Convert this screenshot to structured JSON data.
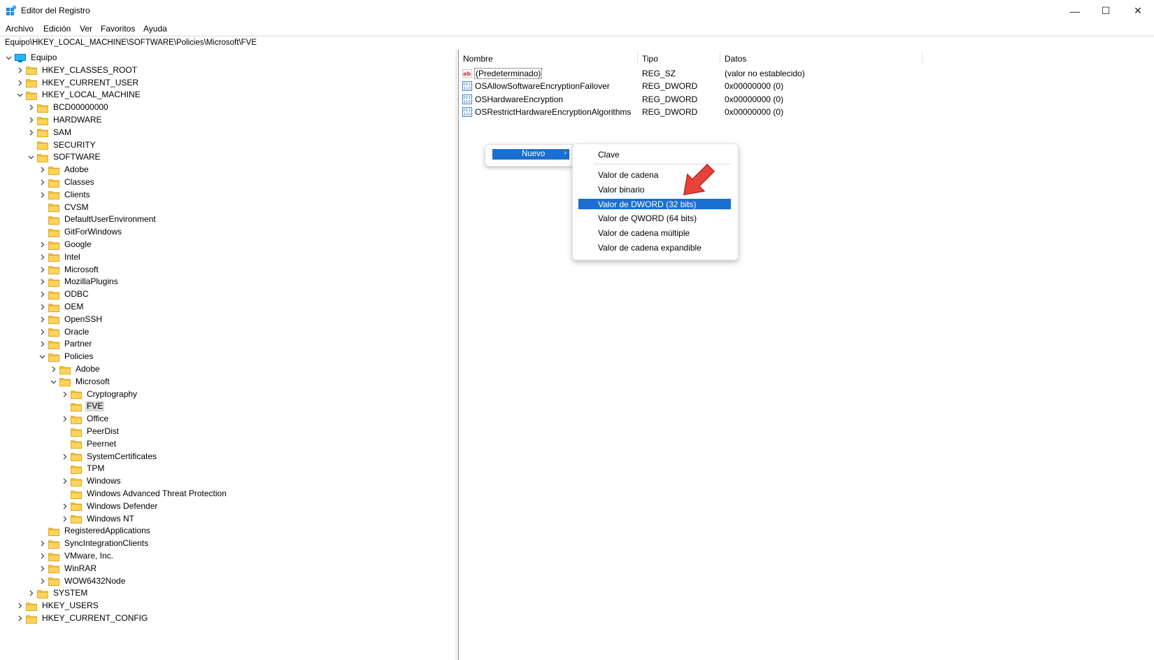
{
  "window": {
    "title": "Editor del Registro",
    "minimize": "—",
    "maximize": "☐",
    "close": "✕"
  },
  "menu": [
    "Archivo",
    "Edición",
    "Ver",
    "Favoritos",
    "Ayuda"
  ],
  "address": "Equipo\\HKEY_LOCAL_MACHINE\\SOFTWARE\\Policies\\Microsoft\\FVE",
  "tree": [
    {
      "label": "Equipo",
      "level": 0,
      "expander": "open",
      "icon": "computer-icon"
    },
    {
      "label": "HKEY_CLASSES_ROOT",
      "level": 1,
      "expander": "closed",
      "icon": "folder-icon"
    },
    {
      "label": "HKEY_CURRENT_USER",
      "level": 1,
      "expander": "closed",
      "icon": "folder-icon"
    },
    {
      "label": "HKEY_LOCAL_MACHINE",
      "level": 1,
      "expander": "open",
      "icon": "folder-icon"
    },
    {
      "label": "BCD00000000",
      "level": 2,
      "expander": "closed",
      "icon": "folder-icon"
    },
    {
      "label": "HARDWARE",
      "level": 2,
      "expander": "closed",
      "icon": "folder-icon"
    },
    {
      "label": "SAM",
      "level": 2,
      "expander": "closed",
      "icon": "folder-icon"
    },
    {
      "label": "SECURITY",
      "level": 2,
      "expander": "none",
      "icon": "folder-icon"
    },
    {
      "label": "SOFTWARE",
      "level": 2,
      "expander": "open",
      "icon": "folder-icon"
    },
    {
      "label": "Adobe",
      "level": 3,
      "expander": "closed",
      "icon": "folder-icon"
    },
    {
      "label": "Classes",
      "level": 3,
      "expander": "closed",
      "icon": "folder-icon"
    },
    {
      "label": "Clients",
      "level": 3,
      "expander": "closed",
      "icon": "folder-icon"
    },
    {
      "label": "CVSM",
      "level": 3,
      "expander": "none",
      "icon": "folder-icon"
    },
    {
      "label": "DefaultUserEnvironment",
      "level": 3,
      "expander": "none",
      "icon": "folder-icon"
    },
    {
      "label": "GitForWindows",
      "level": 3,
      "expander": "none",
      "icon": "folder-icon"
    },
    {
      "label": "Google",
      "level": 3,
      "expander": "closed",
      "icon": "folder-icon"
    },
    {
      "label": "Intel",
      "level": 3,
      "expander": "closed",
      "icon": "folder-icon"
    },
    {
      "label": "Microsoft",
      "level": 3,
      "expander": "closed",
      "icon": "folder-icon"
    },
    {
      "label": "MozillaPlugins",
      "level": 3,
      "expander": "closed",
      "icon": "folder-icon"
    },
    {
      "label": "ODBC",
      "level": 3,
      "expander": "closed",
      "icon": "folder-icon"
    },
    {
      "label": "OEM",
      "level": 3,
      "expander": "closed",
      "icon": "folder-icon"
    },
    {
      "label": "OpenSSH",
      "level": 3,
      "expander": "closed",
      "icon": "folder-icon"
    },
    {
      "label": "Oracle",
      "level": 3,
      "expander": "closed",
      "icon": "folder-icon"
    },
    {
      "label": "Partner",
      "level": 3,
      "expander": "closed",
      "icon": "folder-icon"
    },
    {
      "label": "Policies",
      "level": 3,
      "expander": "open",
      "icon": "folder-icon"
    },
    {
      "label": "Adobe",
      "level": 4,
      "expander": "closed",
      "icon": "folder-icon"
    },
    {
      "label": "Microsoft",
      "level": 4,
      "expander": "open",
      "icon": "folder-icon"
    },
    {
      "label": "Cryptography",
      "level": 5,
      "expander": "closed",
      "icon": "folder-icon"
    },
    {
      "label": "FVE",
      "level": 5,
      "expander": "none",
      "icon": "folder-icon",
      "selected": true
    },
    {
      "label": "Office",
      "level": 5,
      "expander": "closed",
      "icon": "folder-icon"
    },
    {
      "label": "PeerDist",
      "level": 5,
      "expander": "none",
      "icon": "folder-icon"
    },
    {
      "label": "Peernet",
      "level": 5,
      "expander": "none",
      "icon": "folder-icon"
    },
    {
      "label": "SystemCertificates",
      "level": 5,
      "expander": "closed",
      "icon": "folder-icon"
    },
    {
      "label": "TPM",
      "level": 5,
      "expander": "none",
      "icon": "folder-icon"
    },
    {
      "label": "Windows",
      "level": 5,
      "expander": "closed",
      "icon": "folder-icon"
    },
    {
      "label": "Windows Advanced Threat Protection",
      "level": 5,
      "expander": "none",
      "icon": "folder-icon"
    },
    {
      "label": "Windows Defender",
      "level": 5,
      "expander": "closed",
      "icon": "folder-icon"
    },
    {
      "label": "Windows NT",
      "level": 5,
      "expander": "closed",
      "icon": "folder-icon"
    },
    {
      "label": "RegisteredApplications",
      "level": 3,
      "expander": "none",
      "icon": "folder-icon"
    },
    {
      "label": "SyncIntegrationClients",
      "level": 3,
      "expander": "closed",
      "icon": "folder-icon"
    },
    {
      "label": "VMware, Inc.",
      "level": 3,
      "expander": "closed",
      "icon": "folder-icon"
    },
    {
      "label": "WinRAR",
      "level": 3,
      "expander": "closed",
      "icon": "folder-icon"
    },
    {
      "label": "WOW6432Node",
      "level": 3,
      "expander": "closed",
      "icon": "folder-icon"
    },
    {
      "label": "SYSTEM",
      "level": 2,
      "expander": "closed",
      "icon": "folder-icon"
    },
    {
      "label": "HKEY_USERS",
      "level": 1,
      "expander": "closed",
      "icon": "folder-icon"
    },
    {
      "label": "HKEY_CURRENT_CONFIG",
      "level": 1,
      "expander": "closed",
      "icon": "folder-icon"
    }
  ],
  "columns": {
    "name": "Nombre",
    "type": "Tipo",
    "data": "Datos"
  },
  "values": [
    {
      "name": "(Predeterminado)",
      "type": "REG_SZ",
      "data": "(valor no establecido)",
      "icon": "string-value-icon",
      "focused": true
    },
    {
      "name": "OSAllowSoftwareEncryptionFailover",
      "type": "REG_DWORD",
      "data": "0x00000000 (0)",
      "icon": "binary-value-icon"
    },
    {
      "name": "OSHardwareEncryption",
      "type": "REG_DWORD",
      "data": "0x00000000 (0)",
      "icon": "binary-value-icon"
    },
    {
      "name": "OSRestrictHardwareEncryptionAlgorithms",
      "type": "REG_DWORD",
      "data": "0x00000000 (0)",
      "icon": "binary-value-icon"
    }
  ],
  "context_menu": {
    "parent_label": "Nuevo",
    "parent_arrow": "›"
  },
  "submenu": {
    "items": [
      "Clave",
      "Valor de cadena",
      "Valor binario",
      "Valor de DWORD (32 bits)",
      "Valor de QWORD (64 bits)",
      "Valor de cadena múltiple",
      "Valor de cadena expandible"
    ],
    "highlighted": "Valor de DWORD (32 bits)"
  },
  "colors": {
    "highlight": "#1a6fd0",
    "folder": "#f4c542",
    "pointer": "#e8433a"
  }
}
